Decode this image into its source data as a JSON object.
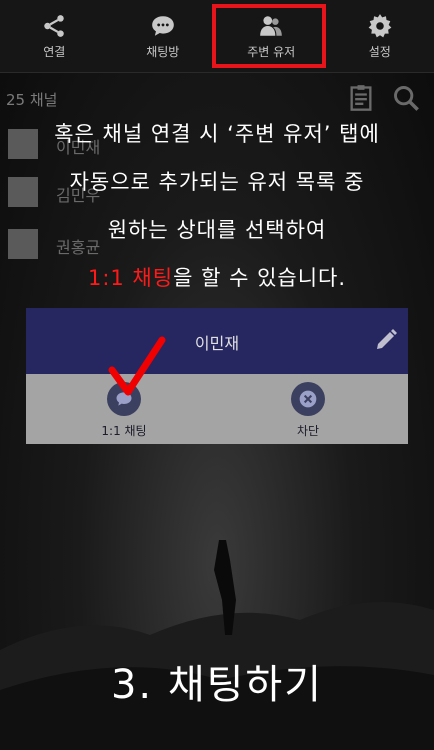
{
  "tabs": [
    {
      "label": "연결",
      "icon": "share-icon"
    },
    {
      "label": "채팅방",
      "icon": "chat-icon"
    },
    {
      "label": "주변 유저",
      "icon": "users-icon"
    },
    {
      "label": "설정",
      "icon": "gear-icon"
    }
  ],
  "list": {
    "count_label": "25 채널",
    "items": [
      {
        "name": "이민재"
      },
      {
        "name": "김민우"
      },
      {
        "name": "권홍균"
      }
    ]
  },
  "overlay": {
    "line1": "혹은 채널 연결 시 ‘주변 유저’ 탭에",
    "line2": "자동으로 추가되는 유저 목록 중",
    "line3": "원하는 상대를 선택하여",
    "line4_red": "1:1 채팅",
    "line4_rest": "을 할 수 있습니다."
  },
  "card": {
    "name": "이민재",
    "actions": [
      {
        "label": "1:1 채팅",
        "icon": "chat-bubble-icon"
      },
      {
        "label": "차단",
        "icon": "close-icon"
      }
    ]
  },
  "step_title": "3. 채팅하기",
  "colors": {
    "highlight": "#e8141c",
    "card_header": "#262660",
    "card_body": "#a4a4a4"
  }
}
